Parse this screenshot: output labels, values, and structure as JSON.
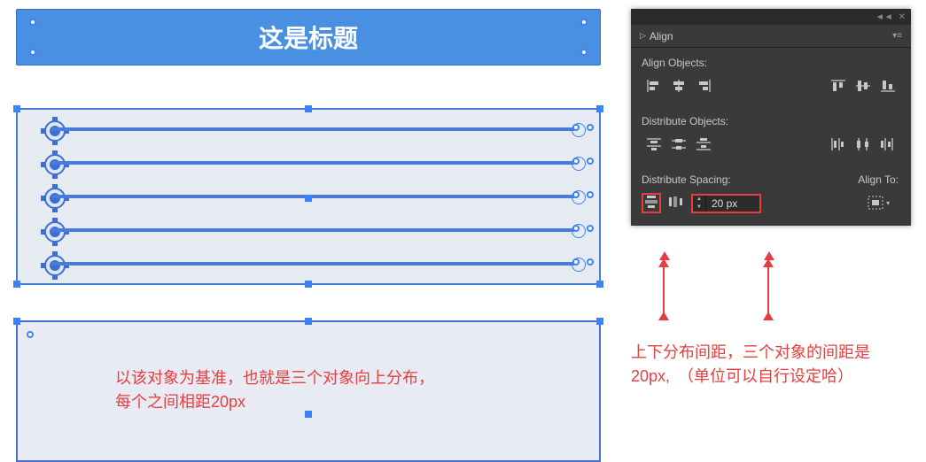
{
  "canvas": {
    "title": "这是标题",
    "annot_line1": "以该对象为基准，也就是三个对象向上分布，",
    "annot_line2": "每个之间相距20px"
  },
  "panel": {
    "tab_label": "Align",
    "section_align": "Align Objects:",
    "section_distribute": "Distribute Objects:",
    "section_spacing": "Distribute Spacing:",
    "align_to_label": "Align To:",
    "spacing_value": "20 px",
    "icons": {
      "align_left": "align-left-icon",
      "align_hcenter": "align-hcenter-icon",
      "align_right": "align-right-icon",
      "align_top": "align-top-icon",
      "align_vcenter": "align-vcenter-icon",
      "align_bottom": "align-bottom-icon",
      "dist_top": "distribute-top-icon",
      "dist_vcenter": "distribute-vcenter-icon",
      "dist_bottom": "distribute-bottom-icon",
      "dist_left": "distribute-left-icon",
      "dist_hcenter": "distribute-hcenter-icon",
      "dist_right": "distribute-right-icon",
      "space_v": "vertical-distribute-space-icon",
      "space_h": "horizontal-distribute-space-icon",
      "align_to": "align-to-selection-icon"
    }
  },
  "panel_annot": {
    "line1": "上下分布间距，三个对象的间距是",
    "line2": "20px,　（单位可以自行设定哈）"
  },
  "colors": {
    "accent": "#4a90e2",
    "red": "#e63e3e"
  }
}
